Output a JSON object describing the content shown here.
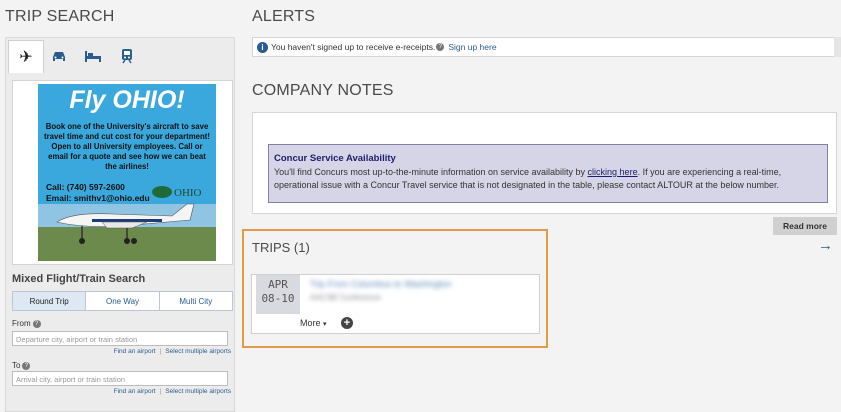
{
  "trip_search": {
    "title": "TRIP SEARCH",
    "mode_tabs": [
      {
        "icon": "flight-icon",
        "glyph": "✈"
      },
      {
        "icon": "car-icon",
        "glyph": "🚗"
      },
      {
        "icon": "hotel-icon",
        "glyph": "🛏"
      },
      {
        "icon": "train-icon",
        "glyph": "🚆"
      }
    ],
    "ad": {
      "headline": "Fly OHIO!",
      "body": "Book one of the University's aircraft to save travel time and cut cost for your department! Open to all University employees. Call or email for a quote and see how we can beat the airlines!",
      "phone": "Call: (740) 597-2600",
      "email": "Email: smithv1@ohio.edu",
      "logo_text": "OHIO"
    },
    "form_heading": "Mixed Flight/Train Search",
    "tabs": [
      "Round Trip",
      "One Way",
      "Multi City"
    ],
    "from_label": "From",
    "from_placeholder": "Departure city, airport or train station",
    "to_label": "To",
    "to_placeholder": "Arrival city, airport or train station",
    "find_airport": "Find an airport",
    "select_multiple": "Select multiple airports"
  },
  "alerts": {
    "title": "ALERTS",
    "message": "You haven't signed up to receive e-receipts.",
    "link": "Sign up here"
  },
  "company_notes": {
    "title": "COMPANY NOTES",
    "notice_title": "Concur Service Availability",
    "text_before": "You'll find Concurs most up-to-the-minute information on service availability by ",
    "link": "clicking here",
    "text_after": ". If you are experiencing a real-time, operational issue with a Concur Travel service that is not designated in the table, please contact ALTOUR at the below number.",
    "read_more": "Read more"
  },
  "trips": {
    "title": "TRIPS (1)",
    "trip": {
      "month": "APR",
      "days": "08-10",
      "name": "Trip From Columbus to Washington",
      "subtitle": "AACSB Conference",
      "more": "More"
    }
  },
  "colors": {
    "accent": "#2a5d8f",
    "trips_highlight": "#e39b4b",
    "notice_bg": "#d5d5e7"
  }
}
